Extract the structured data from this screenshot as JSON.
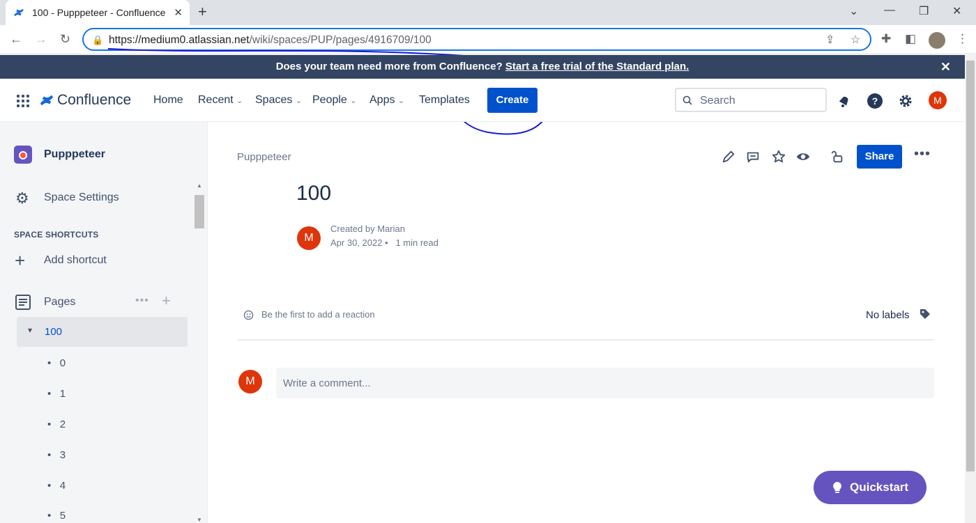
{
  "browser": {
    "tab_title": "100 - Pupppeteer - Confluence",
    "url_host": "https://medium0.atlassian.net",
    "url_path": "/wiki/spaces/PUP/pages/4916709/100"
  },
  "banner": {
    "text": "Does your team need more from Confluence? ",
    "link": "Start a free trial of the Standard plan."
  },
  "topnav": {
    "logo": "Confluence",
    "items": [
      "Home",
      "Recent",
      "Spaces",
      "People",
      "Apps",
      "Templates"
    ],
    "create": "Create",
    "search_placeholder": "Search",
    "avatar": "M"
  },
  "sidebar": {
    "space_name": "Pupppeteer",
    "settings": "Space Settings",
    "shortcuts_heading": "SPACE SHORTCUTS",
    "add_shortcut": "Add shortcut",
    "pages_label": "Pages",
    "selected_page": "100",
    "children": [
      "0",
      "1",
      "2",
      "3",
      "4",
      "5"
    ]
  },
  "page": {
    "breadcrumb": "Pupppeteer",
    "title": "100",
    "created_by": "Created by Marian",
    "date": "Apr 30, 2022",
    "read_time": "1 min read",
    "author_avatar": "M",
    "share": "Share",
    "reaction": "Be the first to add a reaction",
    "labels": "No labels",
    "comment_placeholder": "Write a comment...",
    "commenter_avatar": "M"
  },
  "quickstart": "Quickstart",
  "colors": {
    "primary": "#0052cc",
    "banner": "#344563",
    "avatar": "#de350b",
    "quickstart": "#6554c0",
    "annotation": "#1a1ad6"
  }
}
